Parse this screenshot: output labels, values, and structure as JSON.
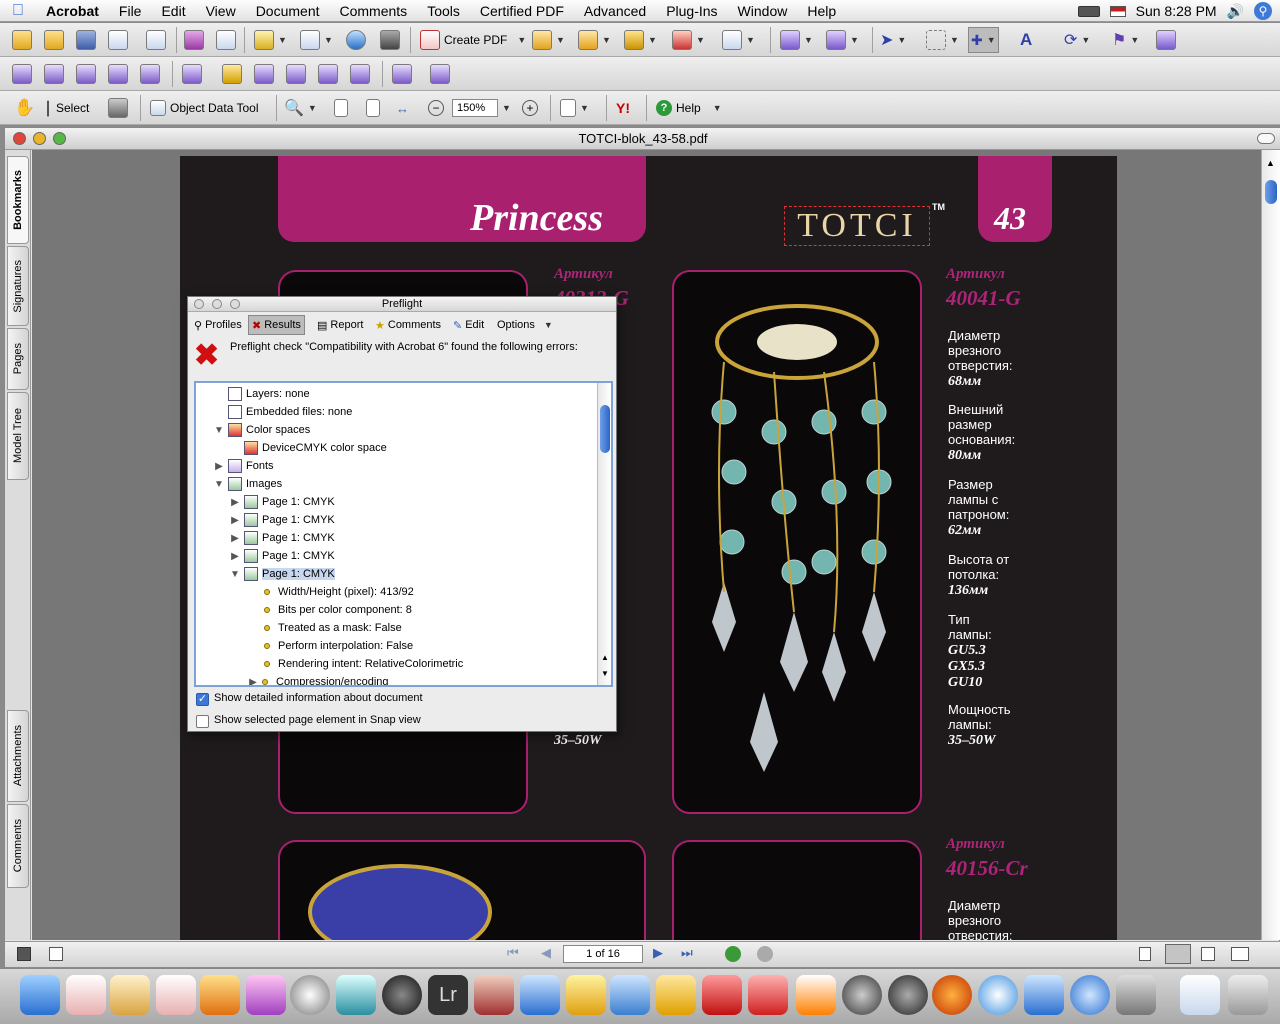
{
  "menubar": {
    "app": "Acrobat",
    "items": [
      "File",
      "Edit",
      "View",
      "Document",
      "Comments",
      "Tools",
      "Certified PDF",
      "Advanced",
      "Plug-Ins",
      "Window",
      "Help"
    ],
    "clock": "Sun 8:28 PM"
  },
  "toolbar": {
    "create_pdf": "Create PDF",
    "select": "Select",
    "object_data_tool": "Object Data Tool",
    "zoom_value": "150%",
    "help": "Help"
  },
  "document": {
    "title": "TOTCI-blok_43-58.pdf",
    "nav_tabs": [
      "Bookmarks",
      "Signatures",
      "Pages",
      "Model Tree",
      "Attachments",
      "Comments"
    ],
    "page_indicator": "1 of 16"
  },
  "page": {
    "heading": "Princess",
    "brand": "TOTCI",
    "trademark": "TM",
    "page_number": "43",
    "product1": {
      "article_label": "Артикул",
      "article": "40313-G",
      "power": "35–50W"
    },
    "product2": {
      "article_label": "Артикул",
      "article": "40041-G",
      "specs": [
        {
          "label": "Диаметр врезного отверстия:",
          "value": "68мм"
        },
        {
          "label": "Внешний размер основания:",
          "value": "80мм"
        },
        {
          "label": "Размер лампы с патроном:",
          "value": "62мм"
        },
        {
          "label": "Высота от потолка:",
          "value": "136мм"
        },
        {
          "label": "Тип лампы:",
          "value": "GU5.3 GX5.3 GU10"
        },
        {
          "label": "Мощность лампы:",
          "value": "35–50W"
        }
      ]
    },
    "product3": {
      "article_label": "Артикул",
      "article": "40156-Cr",
      "spec_label": "Диаметр врезного отверстия:"
    }
  },
  "preflight": {
    "title": "Preflight",
    "tabs": [
      "Profiles",
      "Results",
      "Report",
      "Comments",
      "Edit",
      "Options"
    ],
    "selected_tab": "Results",
    "message": "Preflight check \"Compatibility with Acrobat 6\" found the following errors:",
    "tree": [
      "Layers: none",
      "Embedded files: none",
      "Color spaces",
      "DeviceCMYK color space",
      "Fonts",
      "Images",
      "Page 1: CMYK",
      "Page 1: CMYK",
      "Page 1: CMYK",
      "Page 1: CMYK",
      "Page 1: CMYK",
      "Width/Height (pixel): 413/92",
      "Bits per color component: 8",
      "Treated as a mask: False",
      "Perform interpolation: False",
      "Rendering intent: RelativeColorimetric",
      "Compression/encoding"
    ],
    "checkbox1": "Show detailed information about document",
    "checkbox1_checked": true,
    "checkbox2": "Show selected page element in Snap view",
    "checkbox2_checked": false
  },
  "colors": {
    "brand_magenta": "#a9206f",
    "page_bg": "#1f1b1d"
  }
}
